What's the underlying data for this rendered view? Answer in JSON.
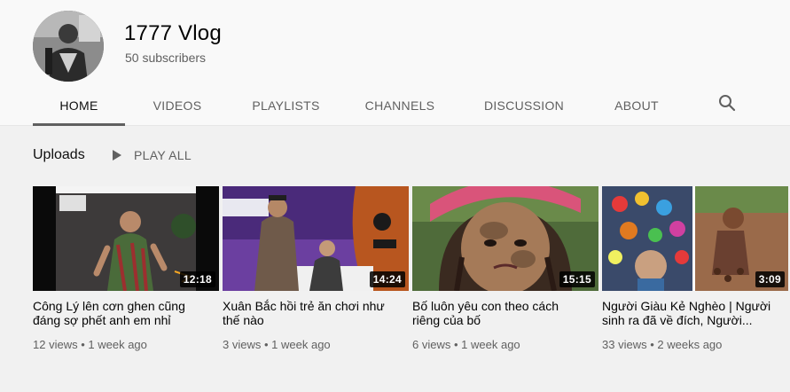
{
  "channel": {
    "name": "1777 Vlog",
    "subscribers": "50 subscribers"
  },
  "tabs": [
    {
      "label": "HOME",
      "active": true
    },
    {
      "label": "VIDEOS"
    },
    {
      "label": "PLAYLISTS"
    },
    {
      "label": "CHANNELS"
    },
    {
      "label": "DISCUSSION"
    },
    {
      "label": "ABOUT"
    }
  ],
  "search_icon": "search-icon",
  "uploads": {
    "title": "Uploads",
    "play_all": "PLAY ALL"
  },
  "videos": [
    {
      "title": "Công Lý lên cơn ghen cũng đáng sợ phết anh em nhỉ",
      "duration": "12:18",
      "views": "12 views",
      "age": "1 week ago"
    },
    {
      "title": "Xuân Bắc hồi trẻ ăn chơi như thế nào",
      "duration": "14:24",
      "views": "3 views",
      "age": "1 week ago"
    },
    {
      "title": "Bố luôn yêu con theo cách riêng của bố",
      "duration": "15:15",
      "views": "6 views",
      "age": "1 week ago"
    },
    {
      "title": "Người Giàu Kẻ Nghèo | Người sinh ra đã về đích, Người...",
      "duration": "3:09",
      "views": "33 views",
      "age": "2 weeks ago"
    }
  ],
  "meta_separator": "•"
}
